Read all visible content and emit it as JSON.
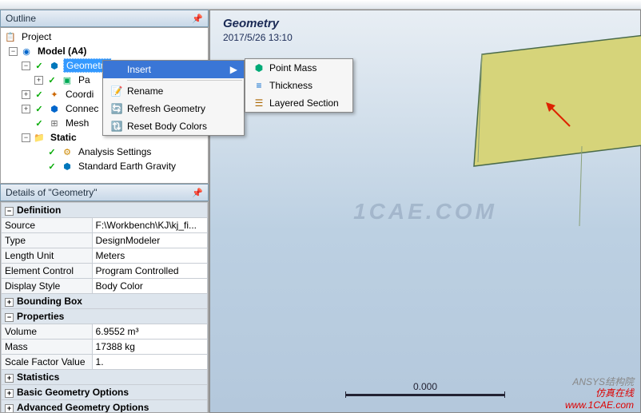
{
  "outline": {
    "title": "Outline",
    "project": "Project",
    "model": "Model (A4)",
    "geometry": "Geometry",
    "part_prefix": "Pa",
    "coord": "Coordi",
    "connect": "Connec",
    "mesh": "Mesh",
    "static": "Static",
    "analysis_settings": "Analysis Settings",
    "gravity": "Standard Earth Gravity"
  },
  "ctx1": {
    "insert": "Insert",
    "rename": "Rename",
    "refresh": "Refresh Geometry",
    "reset": "Reset Body Colors"
  },
  "ctx2": {
    "point_mass": "Point Mass",
    "thickness": "Thickness",
    "layered": "Layered Section"
  },
  "details": {
    "title": "Details of \"Geometry\"",
    "groups": {
      "definition": "Definition",
      "bounding": "Bounding Box",
      "properties": "Properties",
      "statistics": "Statistics",
      "basic_geom": "Basic Geometry Options",
      "adv_geom": "Advanced Geometry Options"
    },
    "rows": {
      "source_k": "Source",
      "source_v": "F:\\Workbench\\KJ\\kj_fi...",
      "type_k": "Type",
      "type_v": "DesignModeler",
      "length_k": "Length Unit",
      "length_v": "Meters",
      "elem_k": "Element Control",
      "elem_v": "Program Controlled",
      "disp_k": "Display Style",
      "disp_v": "Body Color",
      "vol_k": "Volume",
      "vol_v": "6.9552 m³",
      "mass_k": "Mass",
      "mass_v": "17388 kg",
      "scale_k": "Scale Factor Value",
      "scale_v": "1."
    }
  },
  "viewport": {
    "title": "Geometry",
    "date": "2017/5/26 13:10",
    "scale_val": "0.000",
    "watermark": "1CAE.COM",
    "footer1": "ANSYS结构院",
    "footer2": "仿真在线",
    "footer3": "www.1CAE.com"
  }
}
